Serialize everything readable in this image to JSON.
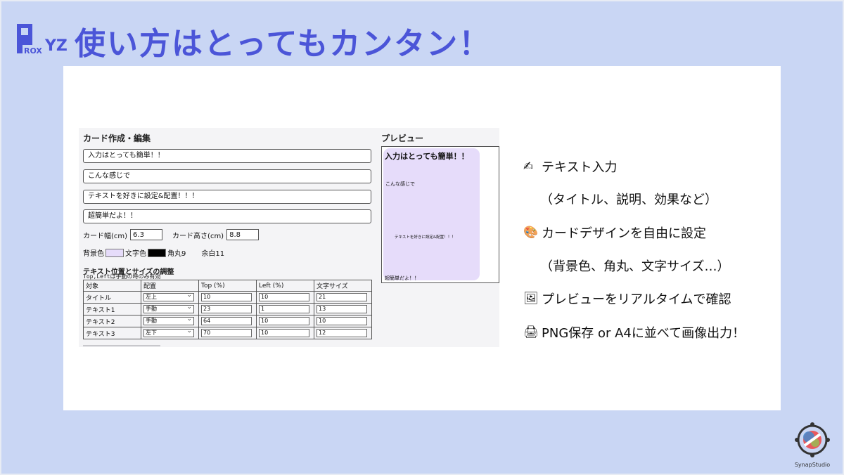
{
  "header": {
    "logo_text": "PROXYZ",
    "title": "使い方はとってもカンタン！"
  },
  "colors": {
    "background": "#c9d6f4",
    "title": "#4b55d8",
    "card_background": "#e6dcfa",
    "text_color_swatch": "#000000"
  },
  "editor": {
    "title": "カード作成・編集",
    "fields": [
      "入力はとっても簡単！！",
      "こんな感じで",
      "テキストを好きに設定&配置！！！",
      "超簡単だよ！！"
    ],
    "width_label": "カード幅(cm)",
    "width_value": "6.3",
    "height_label": "カード高さ(cm)",
    "height_value": "8.8",
    "bg_color_label": "背景色",
    "text_color_label": "文字色",
    "radius_label": "角丸9",
    "margin_label": "余白11",
    "adjust_title": "テキスト位置とサイズの調整",
    "adjust_note": "Top,Leftは手動の時のみ有効",
    "table": {
      "headers": [
        "対象",
        "配置",
        "Top (%)",
        "Left (%)",
        "文字サイズ"
      ],
      "rows": [
        {
          "target": "タイトル",
          "align": "左上",
          "top": "10",
          "left": "10",
          "size": "21"
        },
        {
          "target": "テキスト1",
          "align": "手動",
          "top": "23",
          "left": "1",
          "size": "13"
        },
        {
          "target": "テキスト2",
          "align": "手動",
          "top": "64",
          "left": "10",
          "size": "10"
        },
        {
          "target": "テキスト3",
          "align": "左下",
          "top": "70",
          "left": "10",
          "size": "12"
        }
      ]
    }
  },
  "preview": {
    "label": "プレビュー",
    "title": "入力はとっても簡単！！",
    "text1": "こんな感じで",
    "text2": "テキストを好きに設定&配置！！！",
    "text3": "超簡単だよ！！"
  },
  "features": [
    {
      "icon": "writing-hand-icon",
      "glyph": "✍",
      "text": "テキスト入力"
    },
    {
      "icon": "",
      "glyph": "",
      "text": "（タイトル、説明、効果など）"
    },
    {
      "icon": "palette-icon",
      "glyph": "🎨",
      "text": "カードデザインを自由に設定"
    },
    {
      "icon": "",
      "glyph": "",
      "text": "（背景色、角丸、文字サイズ…）"
    },
    {
      "icon": "framed-picture-icon",
      "glyph": "🖼",
      "text": "プレビューをリアルタイムで確認"
    },
    {
      "icon": "printer-icon",
      "glyph": "🖨",
      "text": "PNG保存 or A4に並べて画像出力！"
    }
  ],
  "footer": {
    "brand": "SynapStudio"
  }
}
